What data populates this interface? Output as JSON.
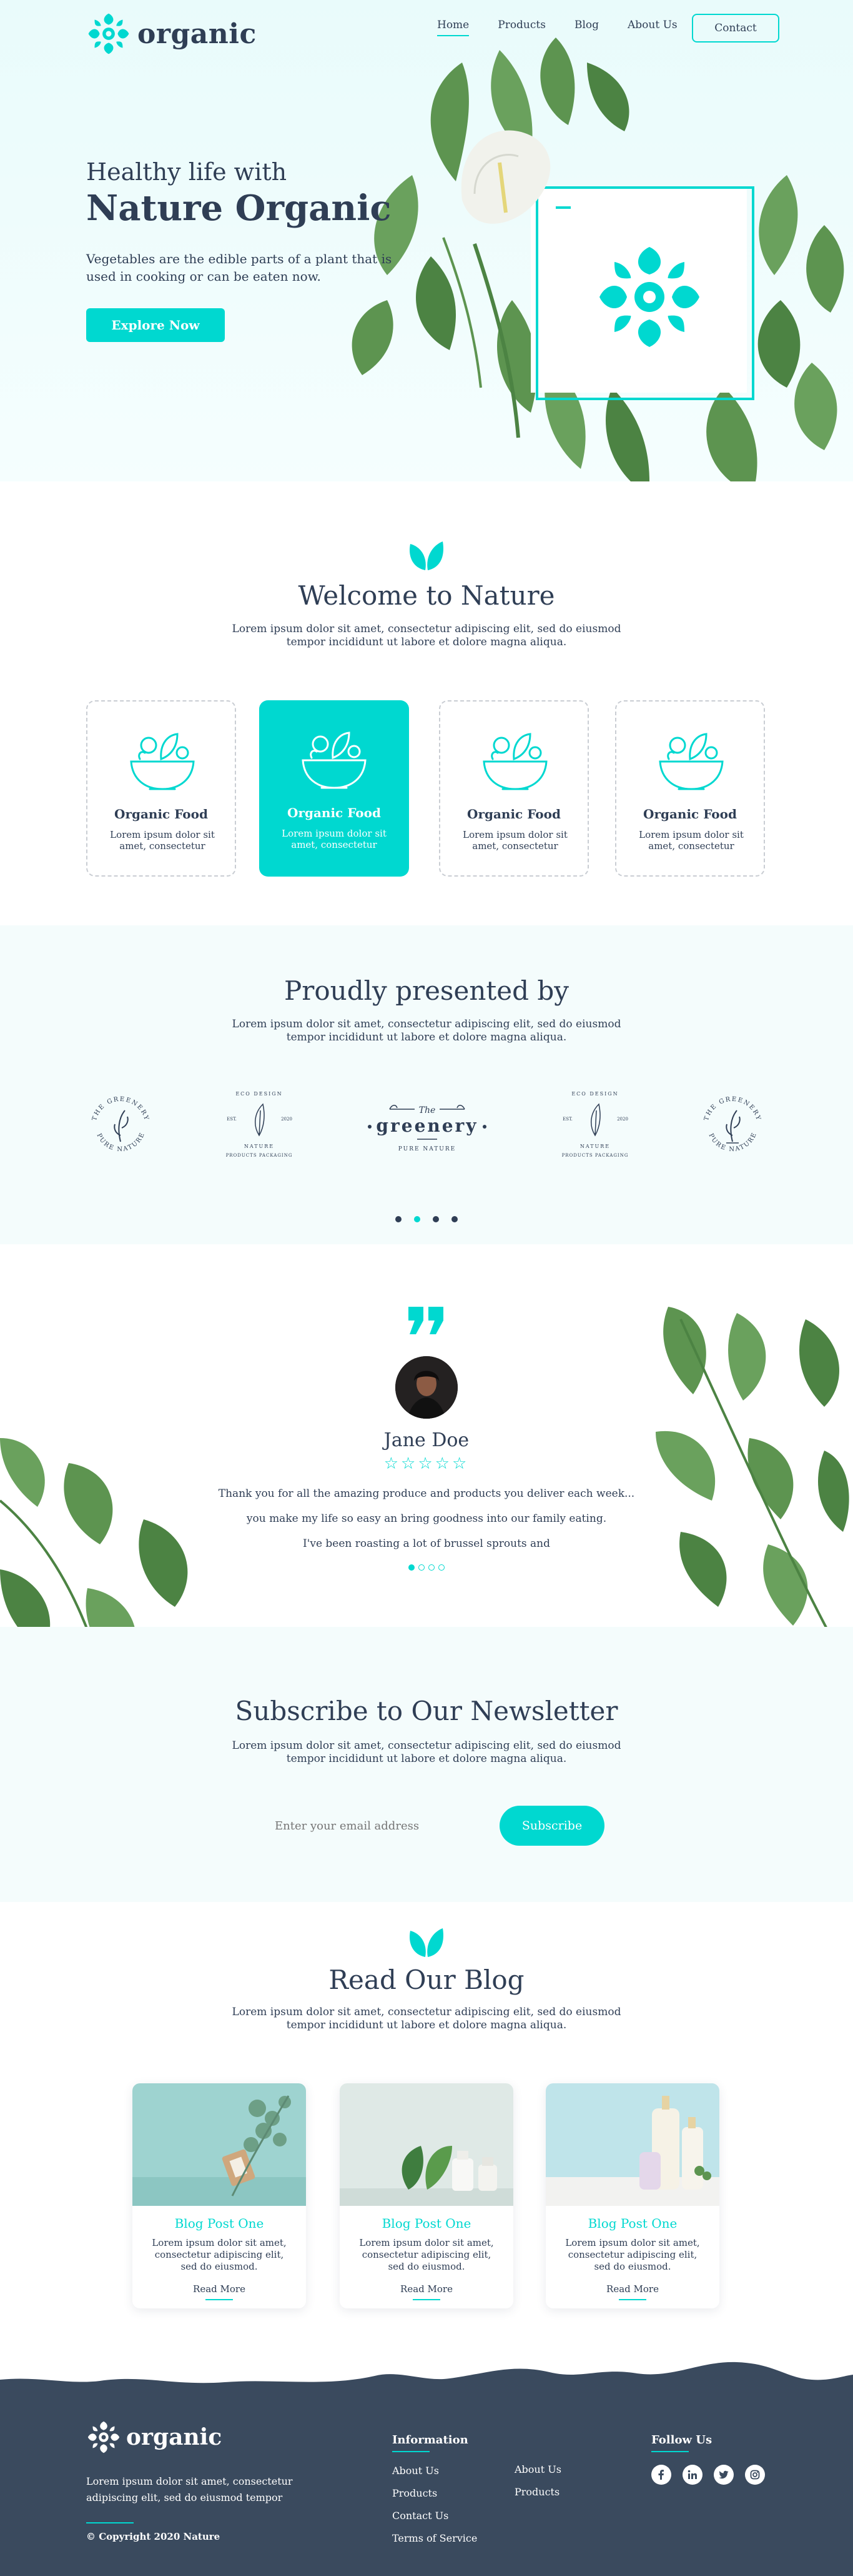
{
  "header": {
    "logo_text": "organic",
    "nav": [
      "Home",
      "Products",
      "Blog",
      "About Us"
    ],
    "contact_label": "Contact"
  },
  "hero": {
    "subtitle": "Healthy life with",
    "title": "Nature Organic",
    "description": "Vegetables are the edible parts of a plant that is used in cooking or can be eaten now.",
    "cta_label": "Explore Now"
  },
  "welcome": {
    "title": "Welcome to Nature",
    "description": "Lorem ipsum dolor sit amet, consectetur adipiscing elit, sed do eiusmod tempor incididunt ut labore et dolore magna aliqua.",
    "cards": [
      {
        "title": "Organic Food",
        "text": "Lorem ipsum dolor sit amet, consectetur"
      },
      {
        "title": "Organic Food",
        "text": "Lorem ipsum dolor sit amet, consectetur"
      },
      {
        "title": "Organic Food",
        "text": "Lorem ipsum dolor sit amet, consectetur"
      },
      {
        "title": "Organic Food",
        "text": "Lorem ipsum dolor sit amet, consectetur"
      }
    ],
    "active_card": 1
  },
  "presented": {
    "title": "Proudly presented by",
    "description": "Lorem ipsum dolor sit amet, consectetur adipiscing elit, sed do eiusmod tempor incididunt ut labore et dolore magna aliqua.",
    "brands": [
      {
        "top": "THE GREENERY",
        "bottom": "PURE NATURE"
      },
      {
        "top": "ECO DESIGN",
        "est": "EST.",
        "year": "2020",
        "mid": "NATURE",
        "bottom": "PRODUCTS PACKAGING"
      },
      {
        "top": "The",
        "main": "greenery",
        "bottom": "PURE NATURE"
      },
      {
        "top": "ECO DESIGN",
        "est": "EST.",
        "year": "2020",
        "mid": "NATURE",
        "bottom": "PRODUCTS PACKAGING"
      },
      {
        "top": "THE GREENERY",
        "bottom": "PURE NATURE"
      }
    ],
    "active_dot": 1
  },
  "testimonial": {
    "name": "Jane Doe",
    "stars": "☆☆☆☆☆",
    "lines": [
      "Thank you for all the amazing produce and products you deliver each week...",
      "you make my life so easy an bring goodness into our family eating.",
      "I've been roasting a lot of brussel sprouts and"
    ],
    "active_dot": 0
  },
  "newsletter": {
    "title": "Subscribe to Our Newsletter",
    "description": "Lorem ipsum dolor sit amet, consectetur adipiscing elit, sed do eiusmod tempor incididunt ut labore et dolore magna aliqua.",
    "email_placeholder": "Enter your email address",
    "button_label": "Subscribe"
  },
  "blog": {
    "title": "Read Our Blog",
    "description": "Lorem ipsum dolor sit amet, consectetur adipiscing elit, sed do eiusmod tempor incididunt ut labore et dolore magna aliqua.",
    "posts": [
      {
        "title": "Blog Post One",
        "text": "Lorem ipsum dolor sit amet, consectetur adipiscing elit, sed do eiusmod.",
        "link": "Read More"
      },
      {
        "title": "Blog Post One",
        "text": "Lorem ipsum dolor sit amet, consectetur adipiscing elit, sed do eiusmod.",
        "link": "Read More"
      },
      {
        "title": "Blog Post One",
        "text": "Lorem ipsum dolor sit amet, consectetur adipiscing elit, sed do eiusmod.",
        "link": "Read More"
      }
    ]
  },
  "footer": {
    "logo_text": "organic",
    "description": "Lorem ipsum dolor sit amet, consectetur adipiscing elit, sed do eiusmod tempor",
    "copyright": "© Copyright 2020 Nature",
    "info_heading": "Information",
    "info_links_col1": [
      "About Us",
      "Products",
      "Contact Us",
      "Terms of Service"
    ],
    "info_links_col2": [
      "About Us",
      "Products"
    ],
    "follow_heading": "Follow Us",
    "social": [
      "facebook-icon",
      "linkedin-icon",
      "twitter-icon",
      "instagram-icon"
    ]
  },
  "colors": {
    "accent": "#00d8d0",
    "text": "#2f3e55",
    "footer_bg": "#3a4a5e",
    "leaf": "#4f8a4a"
  }
}
